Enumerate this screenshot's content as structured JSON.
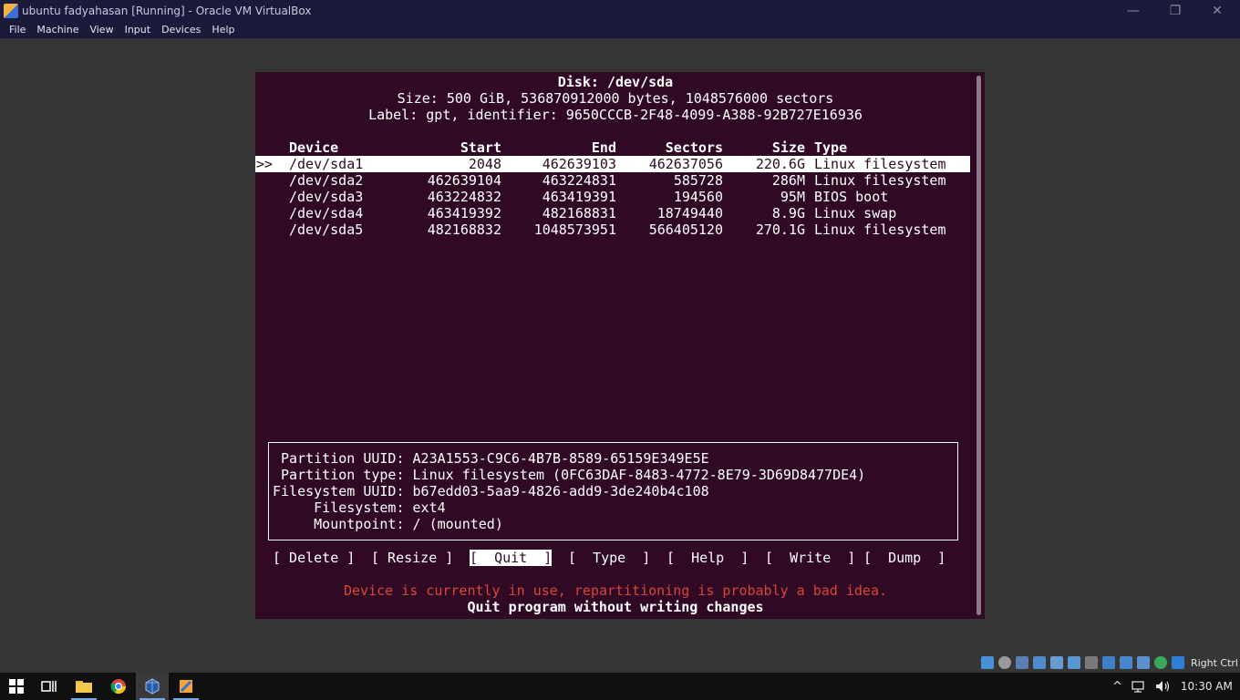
{
  "window": {
    "title": "ubuntu fadyahasan [Running] - Oracle VM VirtualBox",
    "minimize_glyph": "—",
    "maximize_glyph": "❐",
    "close_glyph": "✕"
  },
  "menu": [
    "File",
    "Machine",
    "View",
    "Input",
    "Devices",
    "Help"
  ],
  "disk": {
    "title": "Disk: /dev/sda",
    "size": "Size: 500 GiB, 536870912000 bytes, 1048576000 sectors",
    "label": "Label: gpt, identifier: 9650CCCB-2F48-4099-A388-92B727E16936"
  },
  "table": {
    "headers": {
      "device": "Device",
      "start": "Start",
      "end": "End",
      "sectors": "Sectors",
      "size": "Size",
      "type": "Type"
    },
    "selection_marker": ">>",
    "rows": [
      {
        "device": "/dev/sda1",
        "start": "2048",
        "end": "462639103",
        "sectors": "462637056",
        "size": "220.6G",
        "type": "Linux filesystem"
      },
      {
        "device": "/dev/sda2",
        "start": "462639104",
        "end": "463224831",
        "sectors": "585728",
        "size": "286M",
        "type": "Linux filesystem"
      },
      {
        "device": "/dev/sda3",
        "start": "463224832",
        "end": "463419391",
        "sectors": "194560",
        "size": "95M",
        "type": "BIOS boot"
      },
      {
        "device": "/dev/sda4",
        "start": "463419392",
        "end": "482168831",
        "sectors": "18749440",
        "size": "8.9G",
        "type": "Linux swap"
      },
      {
        "device": "/dev/sda5",
        "start": "482168832",
        "end": "1048573951",
        "sectors": "566405120",
        "size": "270.1G",
        "type": "Linux filesystem"
      }
    ]
  },
  "info": {
    "partition_uuid": " Partition UUID: A23A1553-C9C6-4B7B-8589-65159E349E5E",
    "partition_type": " Partition type: Linux filesystem (0FC63DAF-8483-4772-8E79-3D69D8477DE4)",
    "filesystem_uuid": "Filesystem UUID: b67edd03-5aa9-4826-add9-3de240b4c108",
    "filesystem": "     Filesystem: ext4",
    "mountpoint": "     Mountpoint: / (mounted)"
  },
  "buttons": {
    "delete": "[ Delete ]",
    "resize": "[ Resize ]",
    "quit": "[  Quit  ]",
    "type": "[  Type  ]",
    "help": "[  Help  ]",
    "write": "[  Write  ]",
    "dump": "[  Dump  ]"
  },
  "messages": {
    "warning": "Device is currently in use, repartitioning is probably a bad idea.",
    "hint": "Quit program without writing changes"
  },
  "statusbar": {
    "host_key": "Right Ctrl"
  },
  "taskbar": {
    "clock": "10:30 AM",
    "tray_up_glyph": "^"
  },
  "colors": {
    "terminal_bg": "#300a24",
    "warning": "#d9453a",
    "titlebar": "#1c1a3b"
  }
}
